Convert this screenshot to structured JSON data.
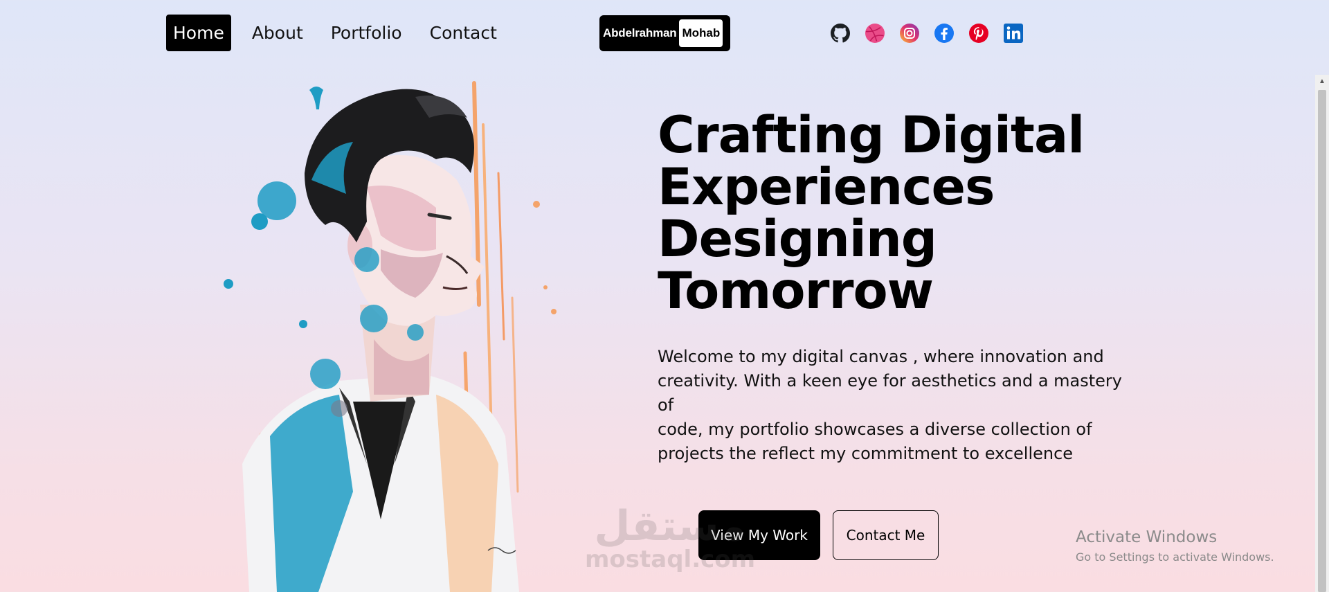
{
  "nav": {
    "items": [
      {
        "label": "Home",
        "active": true
      },
      {
        "label": "About",
        "active": false
      },
      {
        "label": "Portfolio",
        "active": false
      },
      {
        "label": "Contact",
        "active": false
      }
    ]
  },
  "logo": {
    "first": "Abdelrahman",
    "last": "Mohab"
  },
  "socials": [
    {
      "icon": "github-icon",
      "color": "#1b1f23"
    },
    {
      "icon": "dribbble-icon",
      "color": "#ea4c89"
    },
    {
      "icon": "instagram-icon",
      "color": "#c13584"
    },
    {
      "icon": "facebook-icon",
      "color": "#1877f2"
    },
    {
      "icon": "pinterest-icon",
      "color": "#e60023"
    },
    {
      "icon": "linkedin-icon",
      "color": "#0a66c2"
    }
  ],
  "hero": {
    "headline": [
      "Crafting Digital",
      "Experiences",
      "Designing",
      "Tomorrow"
    ],
    "intro_lines": [
      "Welcome to my digital canvas , where innovation and",
      "creativity. With a keen eye for aesthetics and a mastery of",
      "code, my portfolio showcases a diverse collection of",
      "projects the reflect my commitment to excellence"
    ],
    "primary_button": "View My Work",
    "secondary_button": "Contact Me"
  },
  "watermark": {
    "arabic": "مستقل",
    "latin": "mostaql.com"
  },
  "os_notice": {
    "title": "Activate Windows",
    "subtitle": "Go to Settings to activate Windows."
  },
  "colors": {
    "accent": "#000000",
    "background_top": "#dfe6f8",
    "background_bottom": "#fadde2"
  }
}
